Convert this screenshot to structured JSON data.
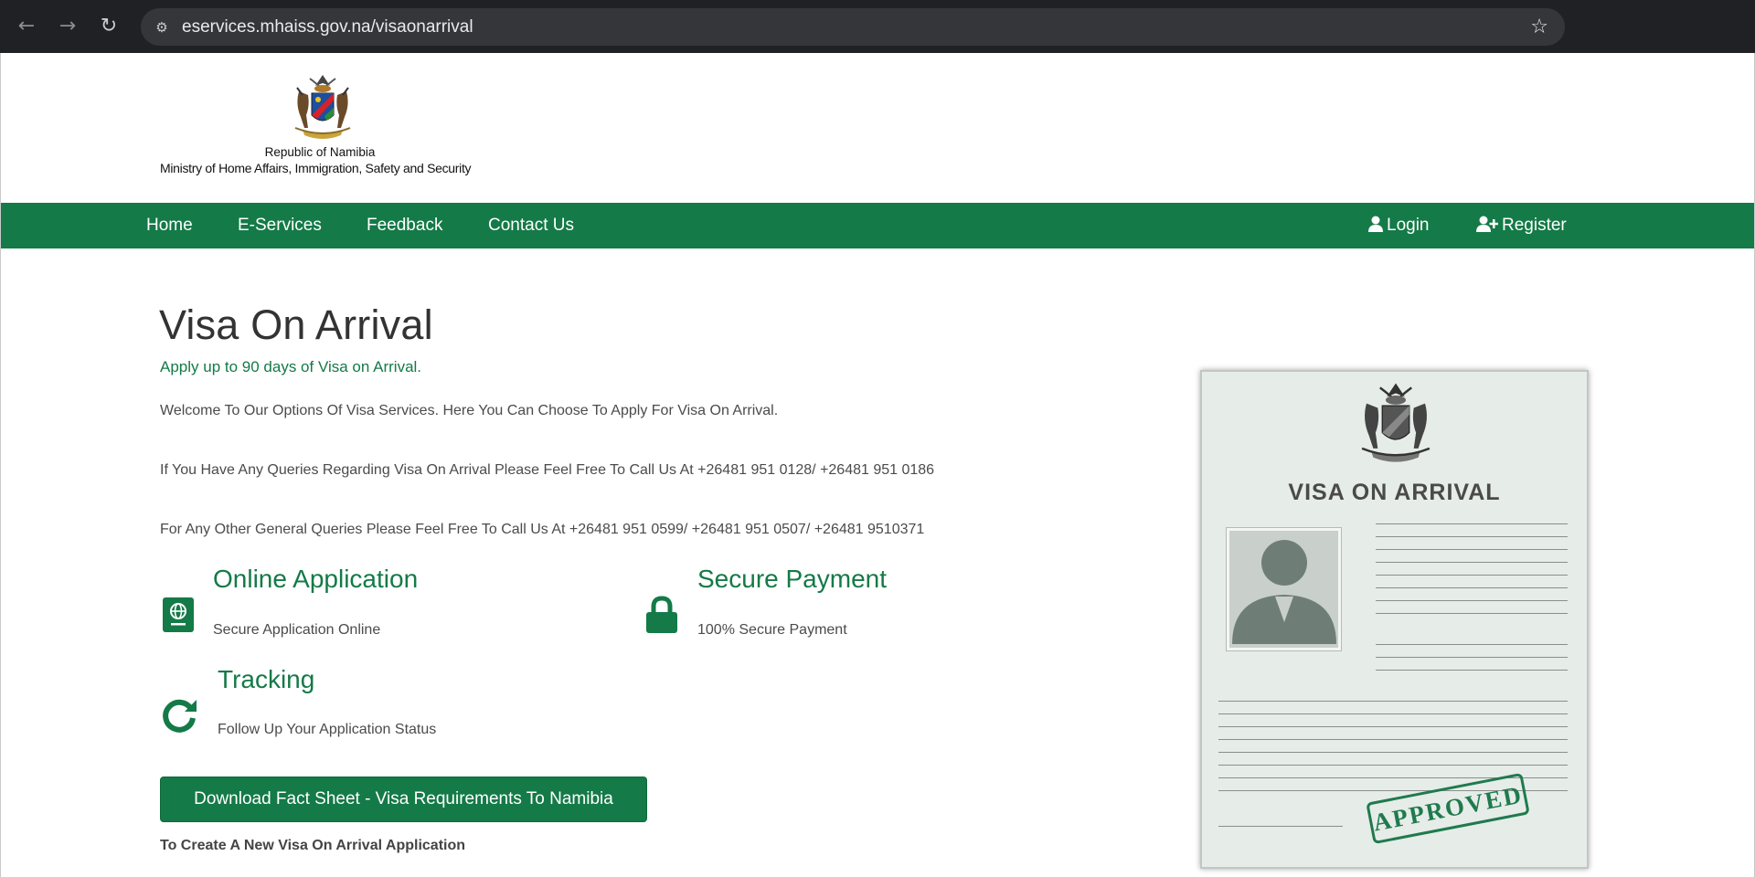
{
  "browser": {
    "url": "eservices.mhaiss.gov.na/visaonarrival",
    "back_icon": "←",
    "forward_icon": "→",
    "reload_icon": "↻",
    "site_info_icon": "⚙",
    "star_icon": "☆"
  },
  "header": {
    "republic": "Republic of Namibia",
    "ministry": "Ministry of Home Affairs, Immigration, Safety and Security"
  },
  "nav": {
    "home": "Home",
    "eservices": "E-Services",
    "feedback": "Feedback",
    "contact": "Contact Us",
    "login": "Login",
    "register": "Register"
  },
  "main": {
    "title": "Visa On Arrival",
    "subtitle": "Apply up to 90 days of Visa on Arrival.",
    "welcome": "Welcome To Our Options Of Visa Services. Here You Can Choose To Apply For Visa On Arrival.",
    "queries_visa": "If You Have Any Queries Regarding Visa On Arrival Please Feel Free To Call Us At +26481 951 0128/ +26481 951 0186",
    "queries_general": "For Any Other General Queries Please Feel Free To Call Us At +26481 951 0599/ +26481 951 0507/ +26481 9510371",
    "features": {
      "online": {
        "title": "Online Application",
        "text": "Secure Application Online"
      },
      "payment": {
        "title": "Secure Payment",
        "text": "100% Secure Payment"
      },
      "tracking": {
        "title": "Tracking",
        "text": "Follow Up Your Application Status"
      }
    },
    "download_button": "Download Fact Sheet - Visa Requirements To Namibia",
    "create_heading": "To Create A New Visa On Arrival Application"
  },
  "card": {
    "title": "VISA ON ARRIVAL",
    "stamp": "APPROVED"
  },
  "colors": {
    "brand_green": "#147a47",
    "browser_dark": "#202124"
  }
}
